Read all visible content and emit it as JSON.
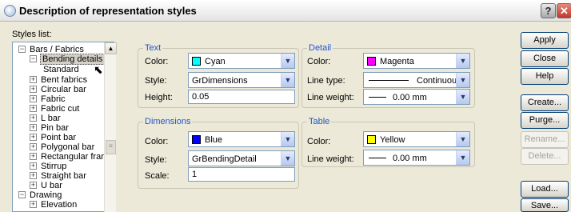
{
  "window": {
    "title": "Description of representation styles"
  },
  "styles_list": {
    "label": "Styles list:",
    "items": [
      {
        "label": "Bars / Fabrics",
        "expander": "−"
      },
      {
        "label": "Bending details",
        "expander": "−"
      },
      {
        "label": "Standard",
        "expander": ""
      },
      {
        "label": "Bent fabrics",
        "expander": "+"
      },
      {
        "label": "Circular bar",
        "expander": "+"
      },
      {
        "label": "Fabric",
        "expander": "+"
      },
      {
        "label": "Fabric cut",
        "expander": "+"
      },
      {
        "label": "L bar",
        "expander": "+"
      },
      {
        "label": "Pin bar",
        "expander": "+"
      },
      {
        "label": "Point bar",
        "expander": "+"
      },
      {
        "label": "Polygonal bar",
        "expander": "+"
      },
      {
        "label": "Rectangular frame",
        "expander": "+"
      },
      {
        "label": "Stirrup",
        "expander": "+"
      },
      {
        "label": "Straight bar",
        "expander": "+"
      },
      {
        "label": "U bar",
        "expander": "+"
      },
      {
        "label": "Drawing",
        "expander": "−"
      },
      {
        "label": "Elevation",
        "expander": "+"
      }
    ]
  },
  "text_group": {
    "title": "Text",
    "color_label": "Color:",
    "color_value": "Cyan",
    "color_hex": "#00ffff",
    "style_label": "Style:",
    "style_value": "GrDimensions",
    "height_label": "Height:",
    "height_value": "0.05"
  },
  "dimensions_group": {
    "title": "Dimensions",
    "color_label": "Color:",
    "color_value": "Blue",
    "color_hex": "#0000ff",
    "style_label": "Style:",
    "style_value": "GrBendingDetail",
    "scale_label": "Scale:",
    "scale_value": "1"
  },
  "detail_group": {
    "title": "Detail",
    "color_label": "Color:",
    "color_value": "Magenta",
    "color_hex": "#ff00ff",
    "line_type_label": "Line type:",
    "line_type_value": "Continuous",
    "line_weight_label": "Line weight:",
    "line_weight_value": "0.00 mm"
  },
  "table_group": {
    "title": "Table",
    "color_label": "Color:",
    "color_value": "Yellow",
    "color_hex": "#ffff00",
    "line_weight_label": "Line weight:",
    "line_weight_value": "0.00 mm"
  },
  "buttons": {
    "apply": "Apply",
    "close": "Close",
    "help": "Help",
    "create": "Create...",
    "purge": "Purge...",
    "rename": "Rename...",
    "delete": "Delete...",
    "load": "Load...",
    "save": "Save..."
  }
}
